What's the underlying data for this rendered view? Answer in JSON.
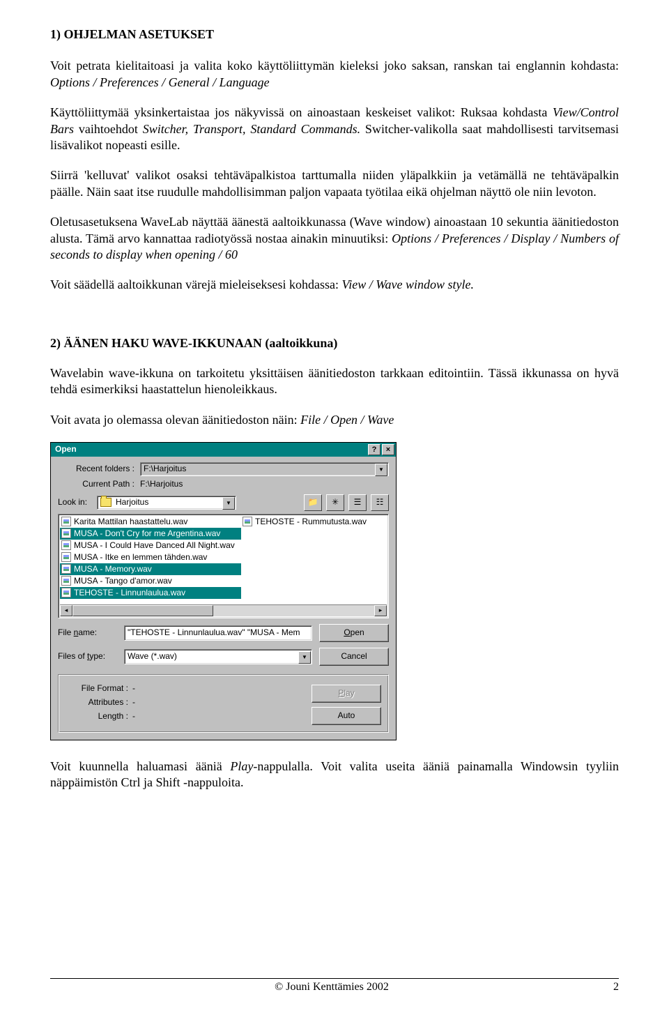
{
  "section1": {
    "title": "1) OHJELMAN ASETUKSET",
    "p1a": "Voit petrata kielitaitoasi ja valita koko käyttöliittymän kieleksi joko saksan, ranskan tai englannin kohdasta: ",
    "p1b": "Options / Preferences / General / Language",
    "p2a": "Käyttöliittymää yksinkertaistaa jos näkyvissä on ainoastaan keskeiset valikot: Ruksaa kohdasta ",
    "p2b": "View/Control Bars",
    "p2c": " vaihtoehdot ",
    "p2d": "Switcher, Transport, Standard Commands.",
    "p2e": "  Switcher-valikolla saat mahdollisesti tarvitsemasi lisävalikot nopeasti esille.",
    "p3": "Siirrä 'kelluvat' valikot osaksi tehtäväpalkistoa tarttumalla niiden yläpalkkiin ja vetämällä ne tehtäväpalkin päälle. Näin saat itse ruudulle mahdollisimman paljon vapaata työtilaa eikä ohjelman näyttö ole niin levoton.",
    "p4a": "Oletusasetuksena WaveLab näyttää äänestä aaltoikkunassa (Wave window) ainoastaan 10 sekuntia äänitiedoston alusta. Tämä arvo kannattaa radiotyössä nostaa ainakin minuutiksi: ",
    "p4b": "Options / Preferences / Display / Numbers of seconds to display when opening / 60",
    "p5a": "Voit säädellä aaltoikkunan värejä mieleiseksesi kohdassa: ",
    "p5b": "View / Wave window style."
  },
  "section2": {
    "title": "2) ÄÄNEN HAKU WAVE-IKKUNAAN (aaltoikkuna)",
    "p1": "Wavelabin wave-ikkuna on tarkoitetu yksittäisen äänitiedoston tarkkaan editointiin. Tässä ikkunassa on hyvä tehdä esimerkiksi haastattelun hienoleikkaus.",
    "p2a": "Voit avata jo olemassa olevan äänitiedoston näin: ",
    "p2b": "File / Open / Wave",
    "p3a": "Voit kuunnella  haluamasi ääniä ",
    "p3b": "Play",
    "p3c": "-nappulalla. Voit valita useita ääniä painamalla Windowsin tyyliin näppäimistön Ctrl ja Shift -nappuloita."
  },
  "dialog": {
    "title": "Open",
    "recent_label": "Recent folders :",
    "recent_value": "F:\\Harjoitus",
    "currentpath_label": "Current Path :",
    "currentpath_value": "F:\\Harjoitus",
    "lookin_label": "Look in:",
    "lookin_value": "Harjoitus",
    "files_col1": [
      {
        "name": "Karita Mattilan haastattelu.wav",
        "selected": false
      },
      {
        "name": "MUSA - Don't Cry for me Argentina.wav",
        "selected": true
      },
      {
        "name": "MUSA - I Could Have Danced All Night.wav",
        "selected": false
      },
      {
        "name": "MUSA - Itke en lemmen tähden.wav",
        "selected": false
      },
      {
        "name": "MUSA - Memory.wav",
        "selected": true
      },
      {
        "name": "MUSA - Tango d'amor.wav",
        "selected": false
      },
      {
        "name": "TEHOSTE - Linnunlaulua.wav",
        "selected": true
      }
    ],
    "files_col2": [
      {
        "name": "TEHOSTE - Rummutusta.wav",
        "selected": false
      }
    ],
    "filename_label": "File name:",
    "filename_value": "\"TEHOSTE - Linnunlaulua.wav\" \"MUSA - Mem",
    "filetype_label": "Files of type:",
    "filetype_value": "Wave (*.wav)",
    "open_btn_u": "O",
    "open_btn_rest": "pen",
    "cancel_btn": "Cancel",
    "fileformat_label": "File Format :",
    "fileformat_value": "-",
    "attributes_label": "Attributes :",
    "attributes_value": "-",
    "length_label": "Length :",
    "length_value": "-",
    "play_btn_u": "P",
    "play_btn_rest": "lay",
    "auto_btn": "Auto"
  },
  "footer": {
    "copyright": "© Jouni Kenttämies 2002",
    "page": "2"
  }
}
